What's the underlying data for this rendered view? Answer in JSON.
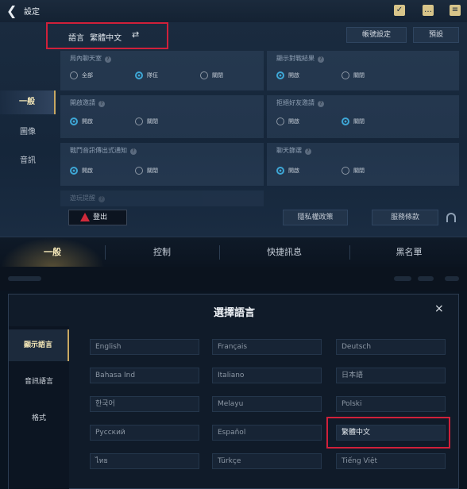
{
  "header": {
    "title": "設定",
    "icons": [
      "check-list-icon",
      "chat-icon",
      "menu-icon"
    ]
  },
  "language_bar": {
    "label": "語言",
    "value": "繁體中文",
    "swap_icon": "⇄"
  },
  "header_buttons": {
    "account_settings": "帳號設定",
    "preset": "預設"
  },
  "sidebar": {
    "items": [
      {
        "label": "一般",
        "active": true
      },
      {
        "label": "圖像",
        "active": false
      },
      {
        "label": "音訊",
        "active": false
      }
    ]
  },
  "settings_cards": [
    {
      "title": "局內聊天室",
      "options": [
        {
          "label": "全部",
          "on": false
        },
        {
          "label": "隊伍",
          "on": true
        },
        {
          "label": "關閉",
          "on": false
        }
      ]
    },
    {
      "title": "顯示對戰結果",
      "options": [
        {
          "label": "開啟",
          "on": true
        },
        {
          "label": "關閉",
          "on": false
        }
      ]
    },
    {
      "title": "開啟邀請",
      "options": [
        {
          "label": "開啟",
          "on": true
        },
        {
          "label": "關閉",
          "on": false
        }
      ]
    },
    {
      "title": "拒絕好友邀請",
      "options": [
        {
          "label": "開啟",
          "on": false
        },
        {
          "label": "關閉",
          "on": true
        }
      ]
    },
    {
      "title": "戰鬥音訊傳出式通知",
      "options": [
        {
          "label": "開啟",
          "on": true
        },
        {
          "label": "關閉",
          "on": false
        }
      ]
    },
    {
      "title": "聊天篩選",
      "options": [
        {
          "label": "開啟",
          "on": true
        },
        {
          "label": "關閉",
          "on": false
        }
      ]
    }
  ],
  "partial_card": {
    "title": "遊玩提醒"
  },
  "footer_buttons": {
    "logout": "登出",
    "privacy": "隱私權政策",
    "terms": "服務條款"
  },
  "tabs": [
    {
      "label": "一般",
      "active": true
    },
    {
      "label": "控制",
      "active": false
    },
    {
      "label": "快捷訊息",
      "active": false
    },
    {
      "label": "黑名單",
      "active": false
    }
  ],
  "modal": {
    "title": "選擇語言",
    "close": "×",
    "side_tabs": [
      {
        "label": "顯示語言",
        "active": true
      },
      {
        "label": "音訊語言",
        "active": false
      },
      {
        "label": "格式",
        "active": false
      }
    ],
    "languages": [
      "English",
      "Français",
      "Deutsch",
      "Bahasa Ind",
      "Italiano",
      "日本語",
      "한국어",
      "Melayu",
      "Polski",
      "Русский",
      "Español",
      "繁體中文",
      "ไทย",
      "Türkçe",
      "Tiếng Việt"
    ],
    "selected": "繁體中文"
  },
  "colors": {
    "accent_gold": "#c8a862",
    "highlight_red": "#d0203a",
    "radio_on": "#3ea7d6"
  }
}
